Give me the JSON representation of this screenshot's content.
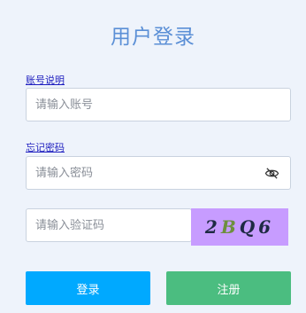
{
  "page": {
    "title": "用户登录"
  },
  "account": {
    "label": "账号说明",
    "placeholder": "请输入账号",
    "value": ""
  },
  "password": {
    "label": "忘记密码",
    "placeholder": "请输入密码",
    "value": "",
    "toggle_icon": "eye-slash-icon"
  },
  "captcha": {
    "placeholder": "请输入验证码",
    "value": "",
    "code_chars": [
      "2",
      "B",
      "Q",
      "6"
    ],
    "background_color": "#c79cff"
  },
  "actions": {
    "login_label": "登录",
    "login_color": "#00a9ff",
    "register_label": "注册",
    "register_color": "#4bbd80"
  }
}
